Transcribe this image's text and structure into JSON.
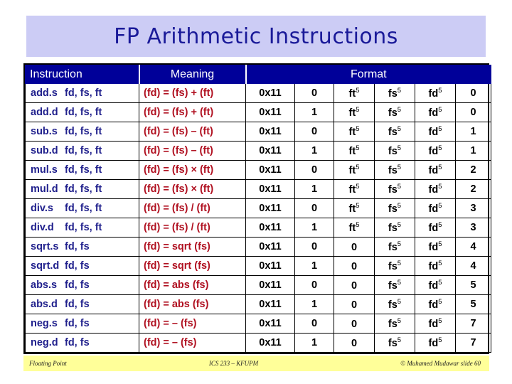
{
  "title": "FP Arithmetic Instructions",
  "table": {
    "headers": {
      "instruction": "Instruction",
      "meaning": "Meaning",
      "format": "Format"
    },
    "rows": [
      {
        "mnemonic": "add.s",
        "operands": "fd, fs, ft",
        "meaning": "(fd) = (fs) + (ft)",
        "opcode": "0x11",
        "fmt": "0",
        "ft": "ft",
        "fs": "fs",
        "fd": "fd",
        "ft_sup": "5",
        "fs_sup": "5",
        "fd_sup": "5",
        "func": "0"
      },
      {
        "mnemonic": "add.d",
        "operands": "fd, fs, ft",
        "meaning": "(fd) = (fs) + (ft)",
        "opcode": "0x11",
        "fmt": "1",
        "ft": "ft",
        "fs": "fs",
        "fd": "fd",
        "ft_sup": "5",
        "fs_sup": "5",
        "fd_sup": "5",
        "func": "0"
      },
      {
        "mnemonic": "sub.s",
        "operands": "fd, fs, ft",
        "meaning": "(fd) = (fs) – (ft)",
        "opcode": "0x11",
        "fmt": "0",
        "ft": "ft",
        "fs": "fs",
        "fd": "fd",
        "ft_sup": "5",
        "fs_sup": "5",
        "fd_sup": "5",
        "func": "1"
      },
      {
        "mnemonic": "sub.d",
        "operands": "fd, fs, ft",
        "meaning": "(fd) = (fs) – (ft)",
        "opcode": "0x11",
        "fmt": "1",
        "ft": "ft",
        "fs": "fs",
        "fd": "fd",
        "ft_sup": "5",
        "fs_sup": "5",
        "fd_sup": "5",
        "func": "1"
      },
      {
        "mnemonic": "mul.s",
        "operands": "fd, fs, ft",
        "meaning": "(fd) = (fs) × (ft)",
        "opcode": "0x11",
        "fmt": "0",
        "ft": "ft",
        "fs": "fs",
        "fd": "fd",
        "ft_sup": "5",
        "fs_sup": "5",
        "fd_sup": "5",
        "func": "2"
      },
      {
        "mnemonic": "mul.d",
        "operands": "fd, fs, ft",
        "meaning": "(fd) = (fs) × (ft)",
        "opcode": "0x11",
        "fmt": "1",
        "ft": "ft",
        "fs": "fs",
        "fd": "fd",
        "ft_sup": "5",
        "fs_sup": "5",
        "fd_sup": "5",
        "func": "2"
      },
      {
        "mnemonic": "div.s",
        "operands": "fd, fs, ft",
        "meaning": "(fd) = (fs) / (ft)",
        "opcode": "0x11",
        "fmt": "0",
        "ft": "ft",
        "fs": "fs",
        "fd": "fd",
        "ft_sup": "5",
        "fs_sup": "5",
        "fd_sup": "5",
        "func": "3"
      },
      {
        "mnemonic": "div.d",
        "operands": "fd, fs, ft",
        "meaning": "(fd) = (fs) / (ft)",
        "opcode": "0x11",
        "fmt": "1",
        "ft": "ft",
        "fs": "fs",
        "fd": "fd",
        "ft_sup": "5",
        "fs_sup": "5",
        "fd_sup": "5",
        "func": "3"
      },
      {
        "mnemonic": "sqrt.s",
        "operands": "fd, fs",
        "meaning": "(fd) = sqrt (fs)",
        "opcode": "0x11",
        "fmt": "0",
        "ft": "0",
        "fs": "fs",
        "fd": "fd",
        "ft_sup": "",
        "fs_sup": "5",
        "fd_sup": "5",
        "func": "4"
      },
      {
        "mnemonic": "sqrt.d",
        "operands": "fd, fs",
        "meaning": "(fd) = sqrt (fs)",
        "opcode": "0x11",
        "fmt": "1",
        "ft": "0",
        "fs": "fs",
        "fd": "fd",
        "ft_sup": "",
        "fs_sup": "5",
        "fd_sup": "5",
        "func": "4"
      },
      {
        "mnemonic": "abs.s",
        "operands": "fd, fs",
        "meaning": "(fd) = abs (fs)",
        "opcode": "0x11",
        "fmt": "0",
        "ft": "0",
        "fs": "fs",
        "fd": "fd",
        "ft_sup": "",
        "fs_sup": "5",
        "fd_sup": "5",
        "func": "5"
      },
      {
        "mnemonic": "abs.d",
        "operands": "fd, fs",
        "meaning": "(fd) = abs (fs)",
        "opcode": "0x11",
        "fmt": "1",
        "ft": "0",
        "fs": "fs",
        "fd": "fd",
        "ft_sup": "",
        "fs_sup": "5",
        "fd_sup": "5",
        "func": "5"
      },
      {
        "mnemonic": "neg.s",
        "operands": "fd, fs",
        "meaning": "(fd) = – (fs)",
        "opcode": "0x11",
        "fmt": "0",
        "ft": "0",
        "fs": "fs",
        "fd": "fd",
        "ft_sup": "",
        "fs_sup": "5",
        "fd_sup": "5",
        "func": "7"
      },
      {
        "mnemonic": "neg.d",
        "operands": "fd, fs",
        "meaning": "(fd) = – (fs)",
        "opcode": "0x11",
        "fmt": "1",
        "ft": "0",
        "fs": "fs",
        "fd": "fd",
        "ft_sup": "",
        "fs_sup": "5",
        "fd_sup": "5",
        "func": "7"
      }
    ]
  },
  "footer": {
    "left": "Floating Point",
    "center": "ICS 233 – KFUPM",
    "right": "© Muhamed Mudawar   slide 60"
  },
  "colors": {
    "title_band": "#ccccf5",
    "title_text": "#1a1a99",
    "header_bg": "#000099",
    "instruction_text": "#1f1f8c",
    "meaning_text": "#b01020",
    "footer_bg": "#ffff99"
  }
}
